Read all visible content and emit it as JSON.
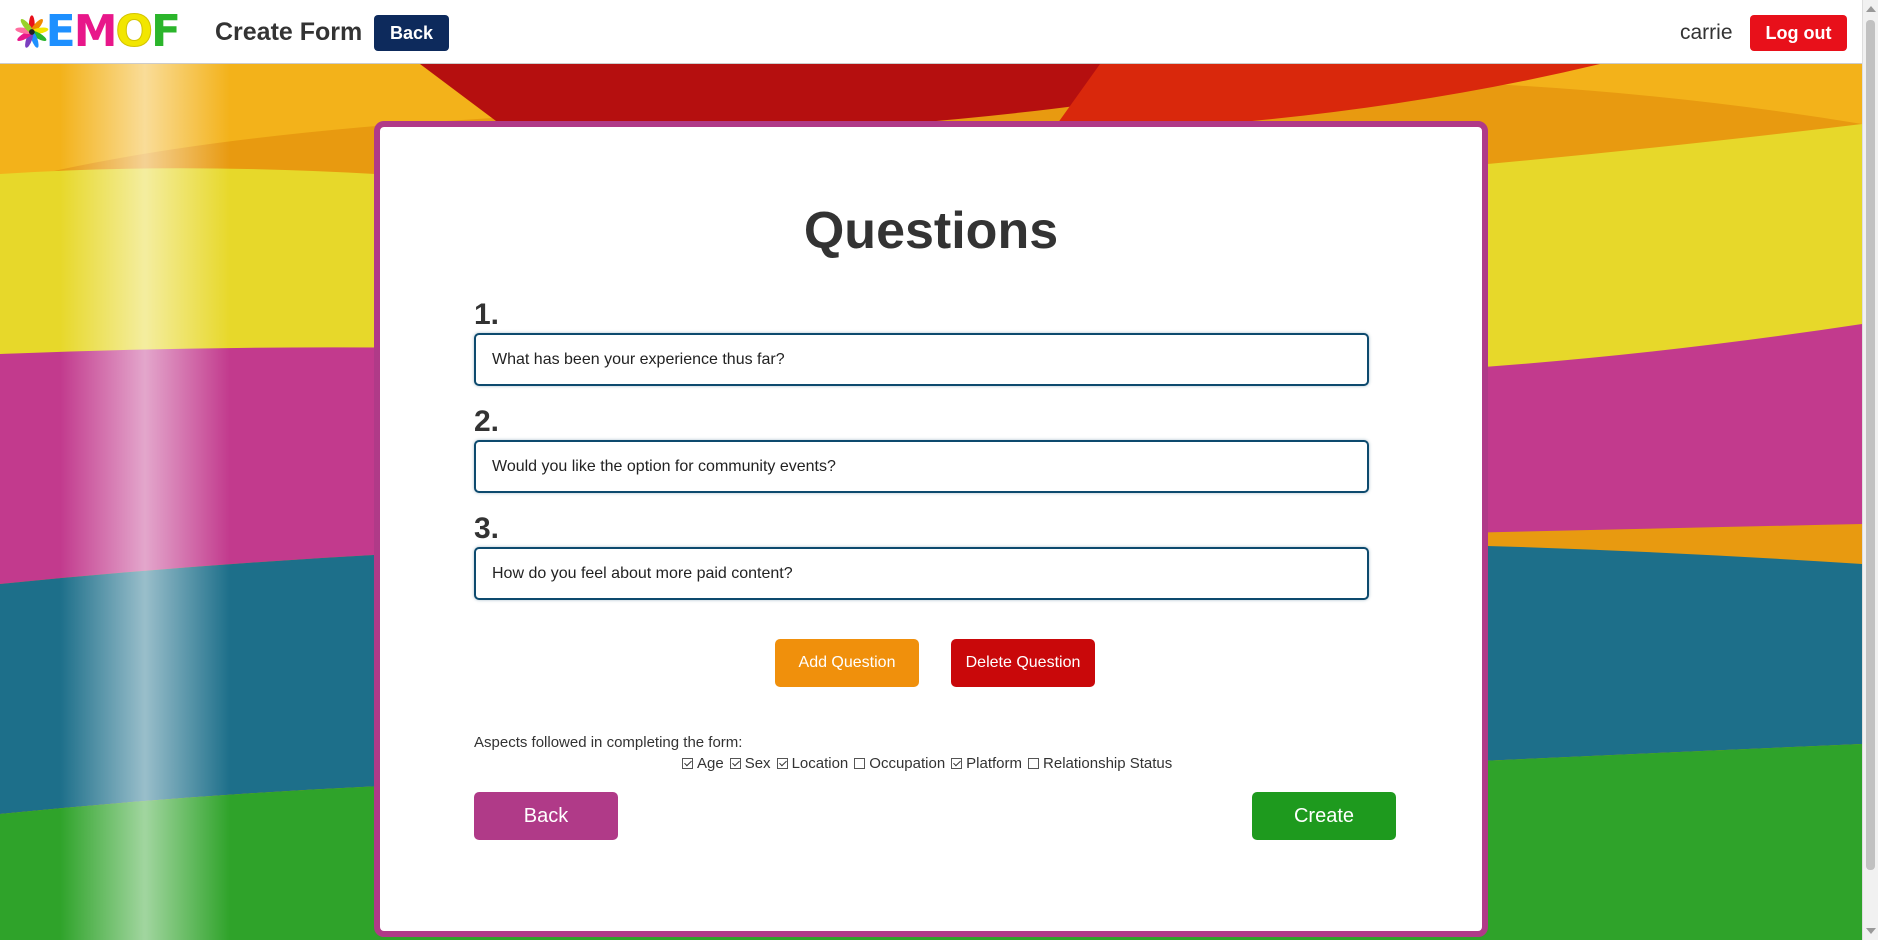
{
  "header": {
    "logo_text": [
      "E",
      "M",
      "O",
      "F"
    ],
    "title": "Create Form",
    "back_label": "Back",
    "username": "carrie",
    "logout_label": "Log out"
  },
  "form": {
    "title": "Questions",
    "questions": [
      {
        "number": "1.",
        "value": "What has been your experience thus far?"
      },
      {
        "number": "2.",
        "value": "Would you like the option for community events?"
      },
      {
        "number": "3.",
        "value": "How do you feel about more paid content?"
      }
    ],
    "add_question_label": "Add Question",
    "delete_question_label": "Delete Question",
    "aspects_label": "Aspects followed in completing the form:",
    "aspects": [
      {
        "label": "Age",
        "checked": true
      },
      {
        "label": "Sex",
        "checked": true
      },
      {
        "label": "Location",
        "checked": true
      },
      {
        "label": "Occupation",
        "checked": false
      },
      {
        "label": "Platform",
        "checked": true
      },
      {
        "label": "Relationship Status",
        "checked": false
      }
    ],
    "back_label": "Back",
    "create_label": "Create"
  },
  "colors": {
    "navy": "#0d2a5c",
    "logout_red": "#e8101a",
    "card_border": "#b03a88",
    "add_orange": "#f0900c",
    "delete_red": "#c9080a",
    "create_green": "#1e9a1e"
  }
}
